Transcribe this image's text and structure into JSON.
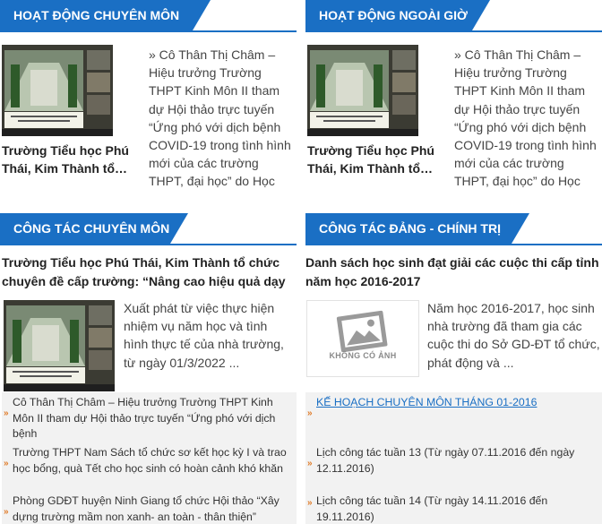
{
  "sections": {
    "hd_chuyen_mon": {
      "title": "HOẠT ĐỘNG CHUYÊN MÔN",
      "feature_title": "Trường Tiểu học Phú Thái, Kim Thành tổ…",
      "feature_desc": "» Cô Thân Thị Châm – Hiệu trưởng Trường THPT Kinh Môn II tham dự Hội thảo trực tuyến “Ứng phó với dịch bệnh COVID-19 trong tình hình mới của các trường THPT, đại học” do Học viện Nông"
    },
    "hd_ngoai_gio": {
      "title": "HOẠT ĐỘNG NGOÀI GIỜ",
      "feature_title": "Trường Tiểu học Phú Thái, Kim Thành tổ…",
      "feature_desc": "» Cô Thân Thị Châm – Hiệu trưởng Trường THPT Kinh Môn II tham dự Hội thảo trực tuyến “Ứng phó với dịch bệnh COVID-19 trong tình hình mới của các trường THPT, đại học” do Học viện Nông"
    },
    "cong_tac_chuyen_mon": {
      "title": "CÔNG TÁC CHUYÊN MÔN",
      "headline": "Trường Tiểu học Phú Thái, Kim Thành tổ chức chuyên đề cấp trường: “Nâng cao hiệu quả dạy",
      "desc": "Xuất phát từ việc thực hiện nhiệm vụ năm học và tình hình thực tế của nhà trường, từ ngày 01/3/2022 ...",
      "list": [
        "Cô Thân Thị Châm – Hiệu trưởng Trường THPT Kinh Môn II tham dự Hội thảo trực tuyến “Ứng phó với dịch bệnh",
        "Trường THPT Nam Sách tổ chức sơ kết học kỳ I và trao học bổng, quà Tết cho học sinh có hoàn cảnh khó khăn",
        "Phòng GDĐT huyện Ninh Giang tổ chức Hội thảo “Xây dựng trường mầm non xanh- an toàn - thân thiện”"
      ]
    },
    "cong_tac_dang": {
      "title": "CÔNG TÁC ĐẢNG - CHÍNH TRỊ",
      "headline": "Danh sách học sinh đạt giải các cuộc thi cấp tỉnh năm học 2016-2017",
      "desc": "Năm học 2016-2017, học sinh nhà trường đã tham gia các cuộc thi do Sở GD-ĐT tổ chức, phát động và ...",
      "no_image_label": "KHÔNG CÓ ẢNH",
      "list": [
        "KẾ HOẠCH CHUYÊN MÔN THÁNG 01-2016",
        "Lịch công tác tuần 13 (Từ ngày 07.11.2016 đến ngày 12.11.2016)",
        "Lịch công tác tuần 14 (Từ ngày 14.11.2016 đến 19.11.2016)"
      ]
    }
  },
  "colors": {
    "accent": "#1a6fc4",
    "arrow": "#e07b28"
  }
}
